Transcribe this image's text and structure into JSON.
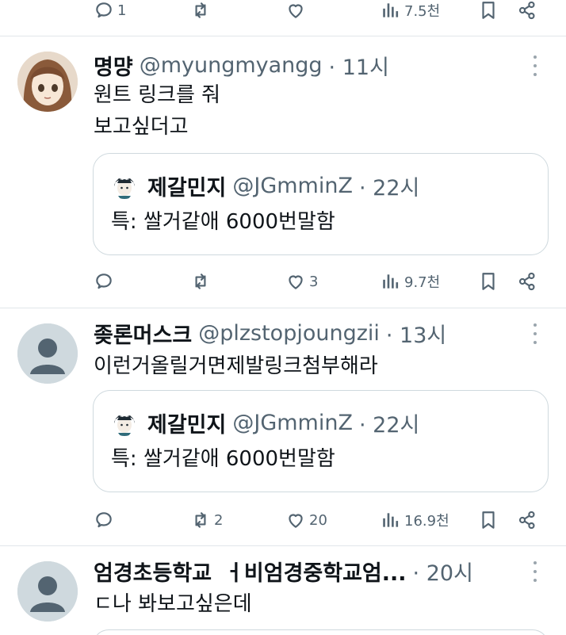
{
  "top_actions": {
    "replies": "1",
    "retweets": "",
    "likes": "",
    "views": "7.5천"
  },
  "tweets": [
    {
      "name": "명먕",
      "handle": "@myungmyangg",
      "time": "· 11시",
      "lines": [
        "원트 링크를 줘",
        "보고싶더고"
      ],
      "quote": {
        "name": "제갈민지",
        "handle": "@JGmminZ",
        "time": "· 22시",
        "text": "특: 쌀거같애 6000번말함"
      },
      "actions": {
        "replies": "",
        "retweets": "",
        "likes": "3",
        "views": "9.7천"
      }
    },
    {
      "name": "좆론머스크",
      "handle": "@plzstopjoungzii",
      "time": "· 13시",
      "lines": [
        "이런거올릴거면제발링크첨부해라"
      ],
      "quote": {
        "name": "제갈민지",
        "handle": "@JGmminZ",
        "time": "· 22시",
        "text": "특: 쌀거같애 6000번말함"
      },
      "actions": {
        "replies": "",
        "retweets": "2",
        "likes": "20",
        "views": "16.9천"
      }
    },
    {
      "name": "엄경초등학교",
      "handle_partial": "ㅓ비엄경중학교엄...",
      "time": "· 20시",
      "lines": [
        "ㄷ나 봐보고싶은데"
      ]
    }
  ],
  "icons": {
    "reply": "reply-icon",
    "retweet": "retweet-icon",
    "like": "heart-icon",
    "views": "views-icon",
    "bookmark": "bookmark-icon",
    "share": "share-icon",
    "more": "more-icon"
  },
  "colors": {
    "text": "#0f1419",
    "muted": "#536471",
    "border": "#cfd9de",
    "divider": "#e1e6ea"
  }
}
